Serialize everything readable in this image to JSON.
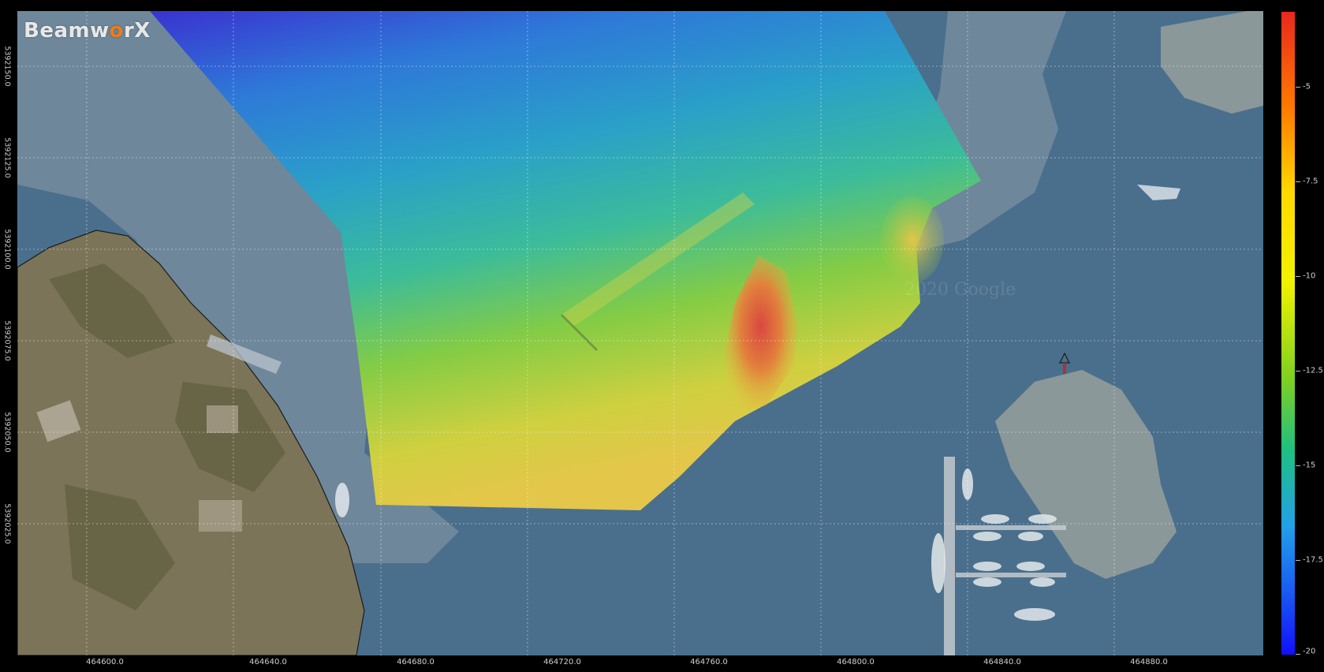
{
  "app": {
    "logo_prefix": "Beamw",
    "logo_accent": "o",
    "logo_suffix": "rX"
  },
  "map": {
    "watermark": "2020 Google",
    "northing_ticks": [
      "5392150.0",
      "5392125.0",
      "5392100.0",
      "5392075.0",
      "5392050.0",
      "5392025.0"
    ],
    "easting_ticks": [
      "464600.0",
      "464640.0",
      "464680.0",
      "464720.0",
      "464760.0",
      "464800.0",
      "464840.0",
      "464880.0"
    ],
    "colors": {
      "water": "#4a6f8c",
      "channel": "#8a9aa6",
      "land": "#7c7458",
      "grid": "#ffffff"
    }
  },
  "colorbar": {
    "labels": [
      "-5",
      "-7.5",
      "-10",
      "-12.5",
      "-15",
      "-17.5",
      "-20"
    ],
    "colors": [
      "#e8281e",
      "#ff7a00",
      "#f2f200",
      "#7fd020",
      "#1fc080",
      "#22a0e8",
      "#1010ff"
    ]
  }
}
